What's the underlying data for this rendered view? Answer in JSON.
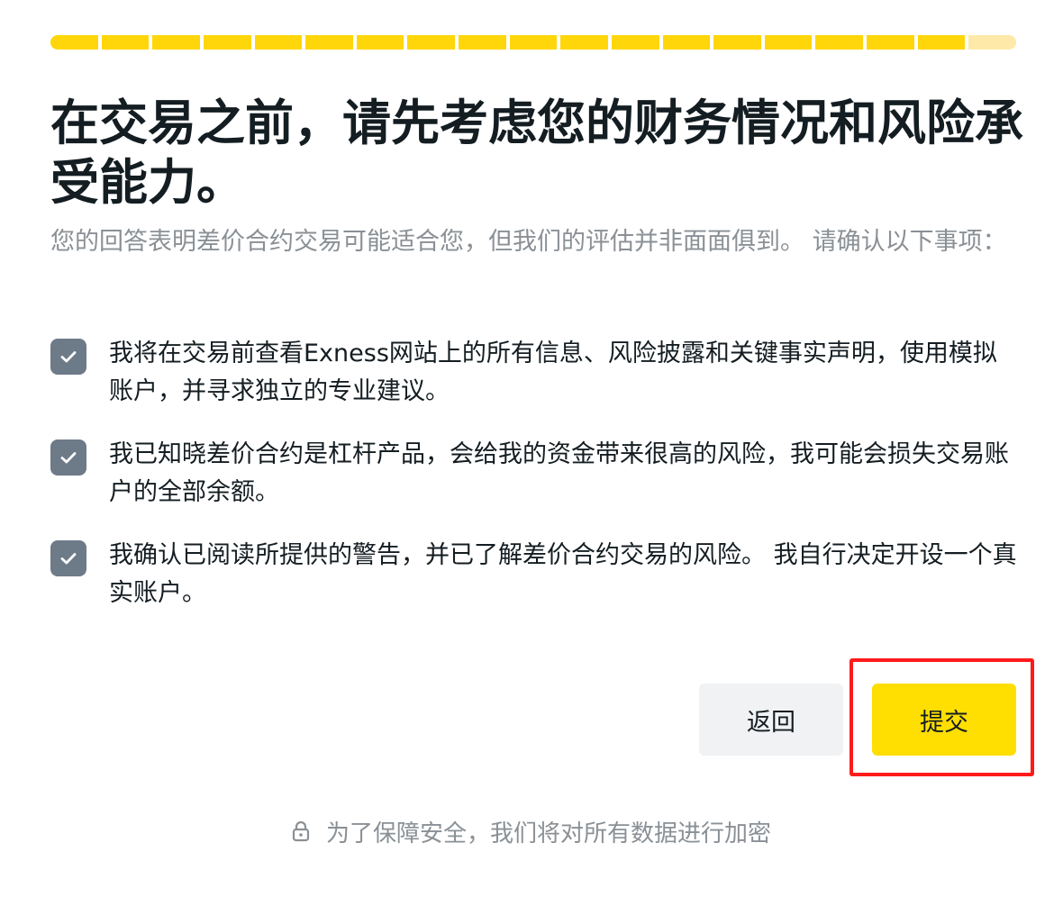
{
  "progress": {
    "completed_steps": 18,
    "total_steps": 19,
    "fill_color": "#ffd60a",
    "empty_color": "#ffe9a8"
  },
  "heading": "在交易之前，请先考虑您的财务情况和风险承受能力。",
  "subheading": "您的回答表明差价合约交易可能适合您，但我们的评估并非面面俱到。 请确认以下事项：",
  "checklist": [
    {
      "checked": true,
      "text": "我将在交易前查看Exness网站上的所有信息、风险披露和关键事实声明，使用模拟账户，并寻求独立的专业建议。"
    },
    {
      "checked": true,
      "text": "我已知晓差价合约是杠杆产品，会给我的资金带来很高的风险，我可能会损失交易账户的全部余额。"
    },
    {
      "checked": true,
      "text": "我确认已阅读所提供的警告，并已了解差价合约交易的风险。 我自行决定开设一个真实账户。"
    }
  ],
  "buttons": {
    "back_label": "返回",
    "submit_label": "提交"
  },
  "footer": {
    "lock_icon": "lock-icon",
    "security_note": "为了保障安全，我们将对所有数据进行加密"
  },
  "colors": {
    "accent": "#ffde02",
    "checkbox": "#6d7a88",
    "highlight": "#ff1a1a"
  }
}
